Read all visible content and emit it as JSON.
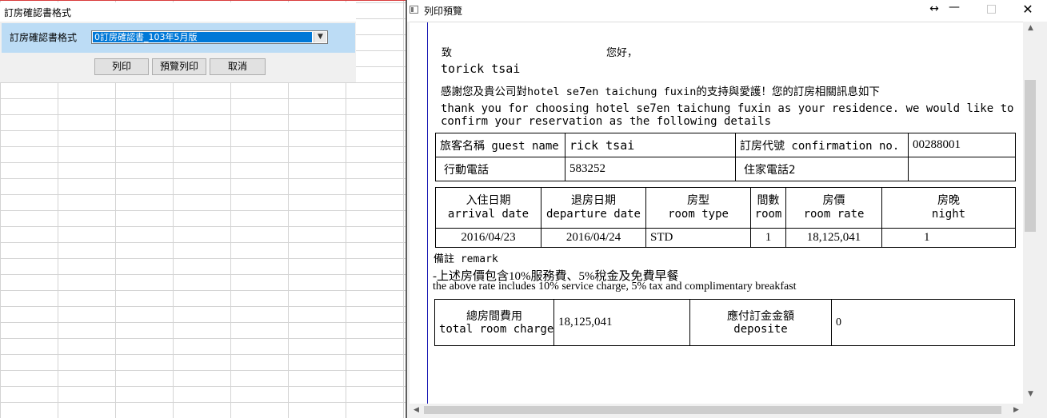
{
  "dialog": {
    "title": "訂房確認書格式",
    "format_label": "訂房確認書格式",
    "format_value": "0訂房確認書_103年5月版",
    "buttons": {
      "print": "列印",
      "preview": "預覽列印",
      "cancel": "取消"
    }
  },
  "preview_window": {
    "title": "列印預覽",
    "controls": {
      "resize": "↔",
      "minimize": "—",
      "close": "✕"
    }
  },
  "document": {
    "greeting_to": "致",
    "greeting_hello": "您好，",
    "recipient": "torick tsai",
    "thanks_zh": "感謝您及貴公司對hotel se7en taichung fuxin的支持與愛護！您的訂房相關訊息如下",
    "thanks_en_1": "thank you for choosing hotel se7en taichung fuxin as your residence. we would like to",
    "thanks_en_2": "confirm your reservation as the following details",
    "guest_table": {
      "guest_name_label": "旅客名稱 guest name",
      "guest_name": "rick tsai",
      "confirmation_label": "訂房代號 confirmation no.",
      "confirmation_no": "00288001",
      "mobile_label": "行動電話",
      "mobile": "583252",
      "home_phone_label": "住家電話2",
      "home_phone": ""
    },
    "stay_table": {
      "headers": [
        {
          "zh": "入住日期",
          "en": "arrival date"
        },
        {
          "zh": "退房日期",
          "en": "departure date"
        },
        {
          "zh": "房型",
          "en": "room type"
        },
        {
          "zh": "間數",
          "en": "room"
        },
        {
          "zh": "房價",
          "en": "room rate"
        },
        {
          "zh": "房晚",
          "en": "night"
        }
      ],
      "row": {
        "arrival": "2016/04/23",
        "departure": "2016/04/24",
        "room_type": "STD",
        "rooms": "1",
        "rate": "18,125,041",
        "nights": "1"
      }
    },
    "remark_label": "備註 remark",
    "remark_zh": "-上述房價包含10%服務費、5%稅金及免費早餐",
    "remark_en": "the above rate includes 10% service charge, 5% tax and complimentary breakfast",
    "total_table": {
      "total_label_zh": "總房間費用",
      "total_label_en": "total room charge",
      "total_value": "18,125,041",
      "deposit_label_zh": "應付訂金金額",
      "deposit_label_en": "deposite",
      "deposit_value": "0"
    }
  }
}
